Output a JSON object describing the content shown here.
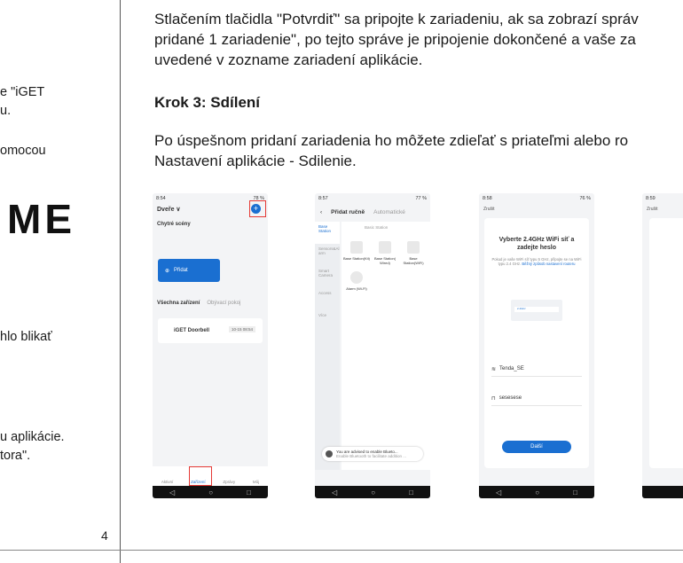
{
  "left_page": {
    "lines": [
      "e \"iGET",
      "u.",
      "omocou",
      "hlo blikať",
      "u aplikácie.",
      "tora\"."
    ],
    "big_text": "ME",
    "page_number": "4"
  },
  "right_page": {
    "para1": [
      "Stlačením tlačidla \"Potvrdiť\" sa pripojte k zariadeniu, ak sa zobrazí správ",
      "pridané 1 zariadenie\", po tejto správe je pripojenie dokončené a vaše za",
      "uvedené v zozname zariadení aplikácie."
    ],
    "heading": "Krok 3: Sdílení",
    "para2": [
      "Po úspešnom pridaní zariadenia ho môžete zdieľať s priateľmi alebo ro",
      "Nastavení aplikácie - Sdilenie."
    ]
  },
  "phone1": {
    "time": "8:54",
    "battery": "78 %",
    "title": "Dveře ∨",
    "scenes": "Chytré scény",
    "add_card": "Přidat",
    "tab_all": "Všechna zařízení",
    "tab_room": "Obývací pokoj",
    "device_name": "iGET Doorbell",
    "device_badge": "10-15 08:54",
    "nav": [
      "Aktivní",
      "Zařízení",
      "Zprávy",
      "Můj"
    ]
  },
  "phone2": {
    "time": "8:57",
    "battery": "77 %",
    "tab_manual": "Přidat ručně",
    "tab_auto": "Automatické",
    "side": [
      "Base Station",
      "Sensors&Al arm",
      "Smart Camera",
      "Access",
      "Více"
    ],
    "section": "Basic Station",
    "items": [
      "Base Station(Kit)",
      "Base Station( Wired)",
      "Base Station(WiFi)",
      "Alarm (Wi-Fi)"
    ],
    "banner_title": "You are advised to enable Blueto...",
    "banner_sub": "Enable Bluetooth to facilitate addition ..."
  },
  "phone3": {
    "time": "8:58",
    "battery": "76 %",
    "cancel": "Zrušit",
    "title_l1": "Vyberte 2.4GHz WiFi síť a",
    "title_l2": "zadejte heslo",
    "sub": "Pokud je vaše WiFi síť typu 5 GHz, připojte se na WiFi typu 2.4 GHz.",
    "sub_link": "Běžný způsob nastavení routeru",
    "router_label": "2.4Ghz",
    "wifi_name": "Tenda_SE",
    "password": "sesesese",
    "button": "Další"
  },
  "phone4": {
    "time": "8:59",
    "cancel": "Zrušit"
  },
  "colors": {
    "accent": "#1a6fd1",
    "highlight": "#e53935"
  }
}
